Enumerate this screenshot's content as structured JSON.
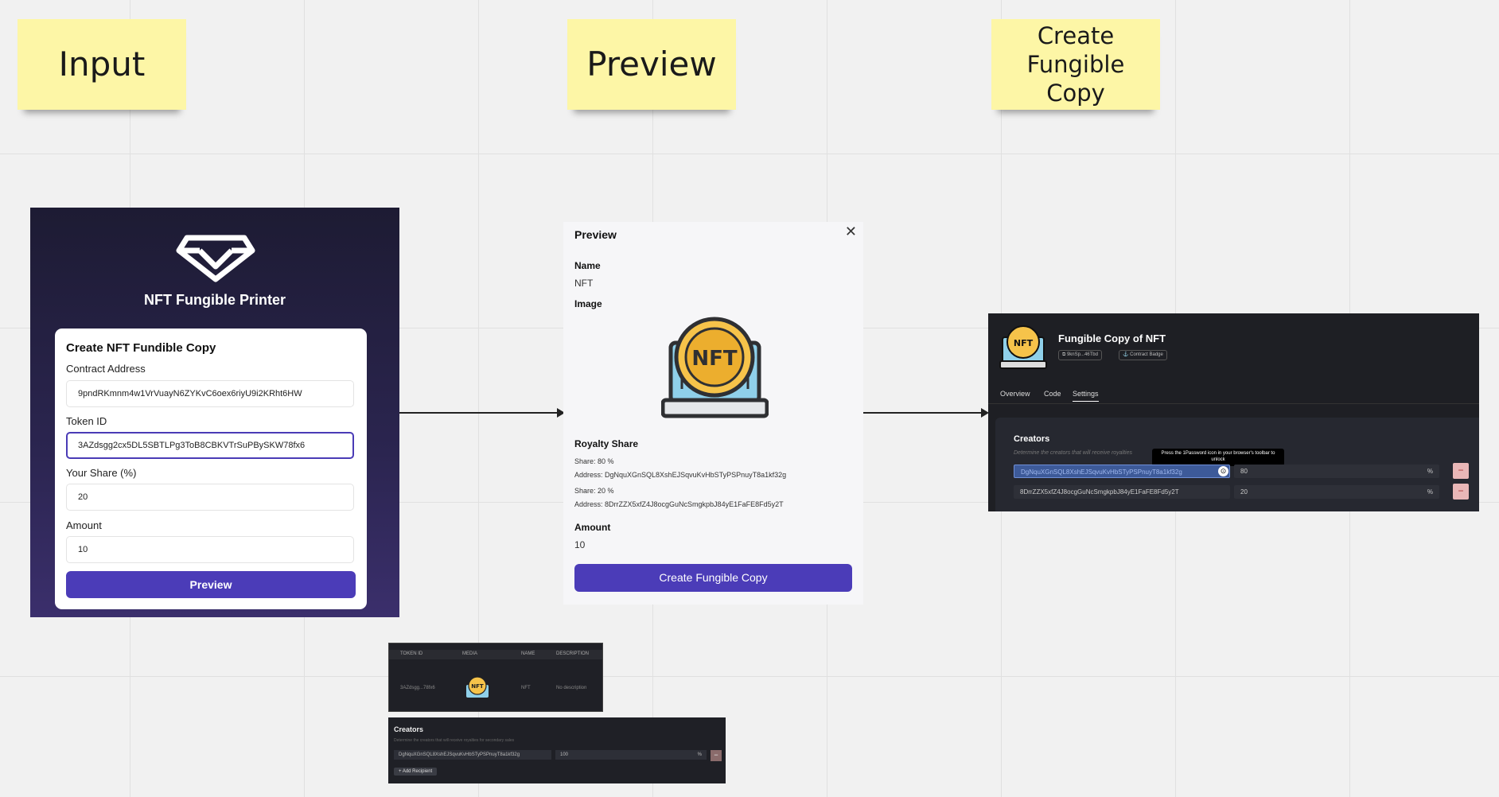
{
  "stickies": {
    "input": "Input",
    "preview": "Preview",
    "create": "Create Fungible Copy"
  },
  "input_panel": {
    "app_title": "NFT Fungible Printer",
    "card_title": "Create NFT Fundible Copy",
    "contract_label": "Contract Address",
    "contract_value": "9pndRKmnm4w1VrVuayN6ZYKvC6oex6riyU9i2KRht6HW",
    "token_label": "Token ID",
    "token_value": "3AZdsgg2cx5DL5SBTLPg3ToB8CBKVTrSuPBySKW78fx6",
    "share_label": "Your Share (%)",
    "share_value": "20",
    "amount_label": "Amount",
    "amount_value": "10",
    "preview_button": "Preview"
  },
  "preview_panel": {
    "title": "Preview",
    "close": "✕",
    "name_label": "Name",
    "name_value": "NFT",
    "image_label": "Image",
    "image_text": "NFT",
    "royalty_label": "Royalty Share",
    "share1": "Share: 80 %",
    "addr1": "Address: DgNquXGnSQL8XshEJSqvuKvHbSTyPSPnuyT8a1kf32g",
    "share2": "Share: 20 %",
    "addr2": "Address: 8DrrZZX5xfZ4J8ocgGuNcSmgkpbJ84yE1FaFE8Fd5y2T",
    "amount_label": "Amount",
    "amount_value": "10",
    "create_button": "Create Fungible Copy"
  },
  "result_panel": {
    "title": "Fungible Copy of NFT",
    "pill1": "9knSp...46Tbd",
    "pill2": "Contract Badge",
    "tabs": [
      "Overview",
      "Code",
      "Settings"
    ],
    "creators_title": "Creators",
    "creators_desc": "Determine the creators that will receive royalties",
    "tooltip": "Press the 1Password icon in your browser's toolbar to unlock",
    "rows": [
      {
        "address": "DgNquXGnSQL8XshEJSqvuKvHbSTyPSPnuyT8a1kf32g",
        "share": "80",
        "unit": "%",
        "remove": "−"
      },
      {
        "address": "8DrrZZX5xfZ4J8ocgGuNcSmgkpbJ84yE1FaFE8Fd5y2T",
        "share": "20",
        "unit": "%",
        "remove": "−"
      }
    ]
  },
  "thumb_table": {
    "headers": [
      "TOKEN ID",
      "MEDIA",
      "NAME",
      "DESCRIPTION"
    ],
    "row": {
      "token": "3AZdsgg...78fx6",
      "name": "NFT",
      "description": "No description"
    }
  },
  "thumb_creators": {
    "title": "Creators",
    "desc": "Determine the creators that will receive royalties for secondary sales",
    "address": "DgNquXGnSQL8XshEJSqvuKvHbSTyPSPnuyT8a1kf32g",
    "share": "100",
    "unit": "%",
    "remove": "−",
    "add_button": "+ Add Recipient"
  },
  "colors": {
    "accent": "#4b3cb8",
    "sticky": "#fdf6a6",
    "dark_bg": "#1e1f24"
  },
  "icons": [
    "diamond-logo-icon",
    "close-icon",
    "nft-laptop-icon",
    "copy-icon",
    "badge-icon",
    "1password-icon"
  ]
}
